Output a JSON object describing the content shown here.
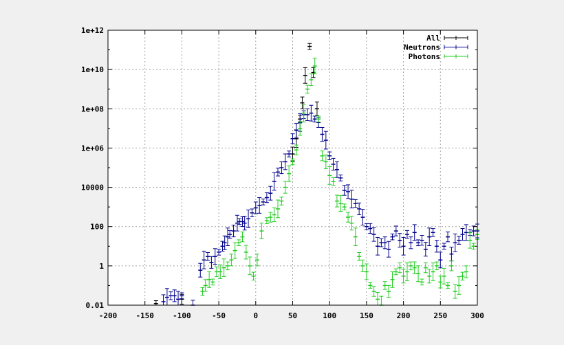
{
  "chart_data": {
    "type": "scatter",
    "title": "",
    "xlabel": "",
    "ylabel": "",
    "xlim": [
      -200,
      300
    ],
    "ylim": [
      0.01,
      1000000000000.0
    ],
    "yscale": "log",
    "grid": true,
    "legend_position": "top-right",
    "x_ticks": [
      "-200",
      "-150",
      "-100",
      "-50",
      "0",
      "50",
      "100",
      "150",
      "200",
      "250",
      "300"
    ],
    "x_tick_values": [
      -200,
      -150,
      -100,
      -50,
      0,
      50,
      100,
      150,
      200,
      250,
      300
    ],
    "y_ticks": [
      "0.01",
      "1",
      "100",
      "10000",
      "1e+06",
      "1e+08",
      "1e+10",
      "1e+12"
    ],
    "y_tick_values": [
      0.01,
      1,
      100,
      10000,
      1000000,
      100000000,
      10000000000,
      1000000000000
    ],
    "series": [
      {
        "name": "All",
        "color": "#000000",
        "points": [
          [
            -135,
            0.012
          ],
          [
            -100,
            0.02
          ],
          [
            50,
            500000
          ],
          [
            55,
            3000000
          ],
          [
            60,
            30000000
          ],
          [
            63,
            200000000
          ],
          [
            67,
            5000000000
          ],
          [
            73,
            150000000000
          ],
          [
            78,
            7000000000
          ],
          [
            83,
            100000000
          ]
        ]
      },
      {
        "name": "Neutrons",
        "color": "#00008b",
        "points": [
          [
            -125,
            0.015
          ],
          [
            -120,
            0.025
          ],
          [
            -115,
            0.03
          ],
          [
            -110,
            0.03
          ],
          [
            -105,
            0.02
          ],
          [
            -100,
            0.03
          ],
          [
            -85,
            0.01
          ],
          [
            -75,
            0.6
          ],
          [
            -70,
            2
          ],
          [
            -65,
            3
          ],
          [
            -60,
            1.5
          ],
          [
            -55,
            3
          ],
          [
            -50,
            5
          ],
          [
            -45,
            10
          ],
          [
            -42,
            15
          ],
          [
            -38,
            30
          ],
          [
            -35,
            40
          ],
          [
            -30,
            60
          ],
          [
            -25,
            150
          ],
          [
            -22,
            180
          ],
          [
            -18,
            180
          ],
          [
            -15,
            150
          ],
          [
            -10,
            250
          ],
          [
            -5,
            500
          ],
          [
            0,
            900
          ],
          [
            5,
            1200
          ],
          [
            10,
            1800
          ],
          [
            15,
            3000
          ],
          [
            20,
            5000
          ],
          [
            25,
            20000
          ],
          [
            30,
            60000
          ],
          [
            35,
            100000
          ],
          [
            40,
            200000
          ],
          [
            45,
            500000
          ],
          [
            50,
            3000000
          ],
          [
            55,
            8000000
          ],
          [
            60,
            20000000
          ],
          [
            65,
            50000000
          ],
          [
            70,
            50000000
          ],
          [
            75,
            60000000
          ],
          [
            80,
            30000000
          ],
          [
            85,
            20000000
          ],
          [
            90,
            5000000
          ],
          [
            95,
            2500000
          ],
          [
            100,
            400000
          ],
          [
            105,
            150000
          ],
          [
            110,
            80000
          ],
          [
            115,
            30000
          ],
          [
            120,
            7000
          ],
          [
            125,
            6000
          ],
          [
            130,
            2500
          ],
          [
            135,
            1500
          ],
          [
            140,
            800
          ],
          [
            145,
            300
          ],
          [
            150,
            100
          ],
          [
            155,
            80
          ],
          [
            160,
            40
          ],
          [
            165,
            10
          ],
          [
            170,
            15
          ],
          [
            175,
            15
          ],
          [
            180,
            7
          ],
          [
            185,
            30
          ],
          [
            190,
            60
          ],
          [
            195,
            20
          ],
          [
            200,
            10
          ],
          [
            205,
            40
          ],
          [
            210,
            15
          ],
          [
            215,
            50
          ],
          [
            220,
            15
          ],
          [
            225,
            20
          ],
          [
            230,
            7
          ],
          [
            235,
            30
          ],
          [
            240,
            50
          ],
          [
            245,
            10
          ],
          [
            250,
            2
          ],
          [
            255,
            10
          ],
          [
            260,
            30
          ],
          [
            265,
            4
          ],
          [
            270,
            15
          ],
          [
            275,
            20
          ],
          [
            280,
            40
          ],
          [
            285,
            50
          ],
          [
            290,
            50
          ],
          [
            295,
            60
          ],
          [
            300,
            60
          ]
        ]
      },
      {
        "name": "Photons",
        "color": "#22cc22",
        "points": [
          [
            -72,
            0.05
          ],
          [
            -68,
            0.1
          ],
          [
            -63,
            0.2
          ],
          [
            -58,
            0.15
          ],
          [
            -53,
            0.5
          ],
          [
            -48,
            0.5
          ],
          [
            -43,
            0.8
          ],
          [
            -38,
            1
          ],
          [
            -33,
            2
          ],
          [
            -28,
            6
          ],
          [
            -23,
            15
          ],
          [
            -18,
            30
          ],
          [
            -13,
            5
          ],
          [
            -8,
            1
          ],
          [
            -3,
            0.3
          ],
          [
            2,
            2
          ],
          [
            8,
            60
          ],
          [
            15,
            200
          ],
          [
            20,
            300
          ],
          [
            25,
            400
          ],
          [
            30,
            800
          ],
          [
            35,
            2000
          ],
          [
            40,
            10000
          ],
          [
            45,
            50000
          ],
          [
            50,
            200000
          ],
          [
            55,
            800000
          ],
          [
            60,
            10000000
          ],
          [
            65,
            60000000
          ],
          [
            70,
            1000000000
          ],
          [
            75,
            3000000000
          ],
          [
            80,
            15000000000
          ],
          [
            85,
            30000000
          ],
          [
            90,
            400000
          ],
          [
            95,
            200000
          ],
          [
            100,
            40000
          ],
          [
            105,
            20000
          ],
          [
            110,
            2000
          ],
          [
            115,
            1500
          ],
          [
            120,
            1000
          ],
          [
            125,
            300
          ],
          [
            130,
            150
          ],
          [
            135,
            30
          ],
          [
            140,
            3
          ],
          [
            145,
            1
          ],
          [
            150,
            0.5
          ],
          [
            155,
            0.1
          ],
          [
            160,
            0.05
          ],
          [
            165,
            0.02
          ],
          [
            170,
            0.01
          ],
          [
            175,
            0.1
          ],
          [
            180,
            0.05
          ],
          [
            185,
            0.2
          ],
          [
            190,
            0.5
          ],
          [
            195,
            0.8
          ],
          [
            200,
            0.3
          ],
          [
            205,
            0.5
          ],
          [
            210,
            1
          ],
          [
            215,
            0.8
          ],
          [
            220,
            0.4
          ],
          [
            225,
            0.15
          ],
          [
            230,
            0.8
          ],
          [
            235,
            0.3
          ],
          [
            240,
            0.5
          ],
          [
            245,
            1
          ],
          [
            250,
            0.15
          ],
          [
            255,
            0.3
          ],
          [
            260,
            0.1
          ],
          [
            265,
            1
          ],
          [
            270,
            0.05
          ],
          [
            275,
            0.1
          ],
          [
            280,
            0.3
          ],
          [
            285,
            0.5
          ],
          [
            290,
            20
          ],
          [
            295,
            10
          ],
          [
            300,
            40
          ]
        ]
      }
    ]
  }
}
